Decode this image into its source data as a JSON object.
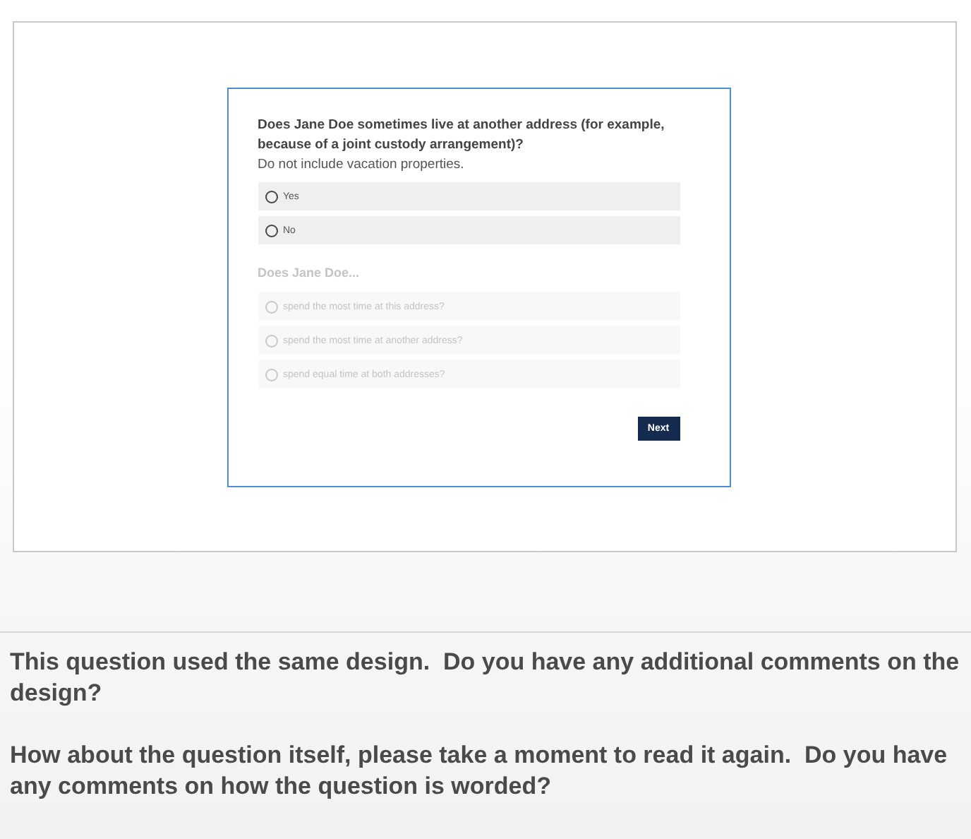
{
  "survey": {
    "question": "Does Jane Doe sometimes live at another address (for example, because of a joint custody arrangement)?",
    "hint": "Do not include vacation properties.",
    "options": [
      {
        "label": "Yes",
        "selected": false,
        "disabled": false
      },
      {
        "label": "No",
        "selected": false,
        "disabled": false
      }
    ],
    "followup_question": "Does Jane Doe...",
    "followup_disabled": true,
    "followup_options": [
      {
        "label": "spend the most time at this address?",
        "selected": false,
        "disabled": true
      },
      {
        "label": "spend the most time at another address?",
        "selected": false,
        "disabled": true
      },
      {
        "label": "spend equal time at both addresses?",
        "selected": false,
        "disabled": true
      }
    ],
    "next_button": "Next"
  },
  "comments": [
    "This question used the same design.  Do you have any additional comments on the design?",
    "How about the question itself, please take a moment to read it again.  Do you have any comments on how the question is worded?"
  ]
}
